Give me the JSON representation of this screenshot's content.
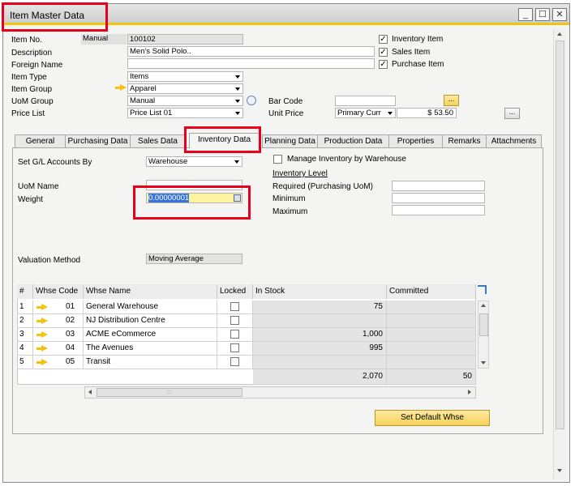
{
  "window": {
    "title": "Item Master Data",
    "controls": {
      "minimize": "_",
      "maximize": "☐",
      "close": "✕"
    }
  },
  "header": {
    "item_no_label": "Item No.",
    "item_no_mode": "Manual",
    "item_no": "100102",
    "description_label": "Description",
    "description": "Men's Solid Polo..",
    "foreign_name_label": "Foreign Name",
    "foreign_name": "",
    "item_type_label": "Item Type",
    "item_type": "Items",
    "item_group_label": "Item Group",
    "item_group": "Apparel",
    "uom_group_label": "UoM Group",
    "uom_group": "Manual",
    "price_list_label": "Price List",
    "price_list": "Price List 01",
    "bar_code_label": "Bar Code",
    "bar_code": "",
    "unit_price_label": "Unit Price",
    "unit_price_currency": "Primary Curr",
    "unit_price": "$ 53.50",
    "ellipsis": "...",
    "inventory_item_label": "Inventory Item",
    "sales_item_label": "Sales Item",
    "purchase_item_label": "Purchase Item",
    "check_mark": "✓"
  },
  "tabs": [
    {
      "label": "General"
    },
    {
      "label": "Purchasing Data"
    },
    {
      "label": "Sales Data"
    },
    {
      "label": "Inventory Data"
    },
    {
      "label": "Planning Data"
    },
    {
      "label": "Production Data"
    },
    {
      "label": "Properties"
    },
    {
      "label": "Remarks"
    },
    {
      "label": "Attachments"
    }
  ],
  "inventory": {
    "gl_label": "Set G/L Accounts By",
    "gl_value": "Warehouse",
    "uom_name_label": "UoM Name",
    "uom_name": "",
    "weight_label": "Weight",
    "weight": "0.00000001",
    "manage_by_wh_label": "Manage Inventory by Warehouse",
    "inventory_level_label": "Inventory Level",
    "required_label": "Required (Purchasing UoM)",
    "minimum_label": "Minimum",
    "maximum_label": "Maximum",
    "valuation_label": "Valuation Method",
    "valuation_value": "Moving Average"
  },
  "grid": {
    "columns": [
      "#",
      "Whse Code",
      "Whse Name",
      "Locked",
      "In Stock",
      "Committed"
    ],
    "rows": [
      {
        "n": "1",
        "code": "01",
        "name": "General Warehouse",
        "in_stock": "75",
        "committed": ""
      },
      {
        "n": "2",
        "code": "02",
        "name": "NJ Distribution Centre",
        "in_stock": "",
        "committed": ""
      },
      {
        "n": "3",
        "code": "03",
        "name": "ACME eCommerce",
        "in_stock": "1,000",
        "committed": ""
      },
      {
        "n": "4",
        "code": "04",
        "name": "The Avenues",
        "in_stock": "995",
        "committed": ""
      },
      {
        "n": "5",
        "code": "05",
        "name": "Transit",
        "in_stock": "",
        "committed": ""
      }
    ],
    "totals": {
      "in_stock": "2,070",
      "committed": "50"
    },
    "hscroll_grip": ":::"
  },
  "buttons": {
    "set_default_whse": "Set Default Whse"
  },
  "colors": {
    "accent_yellow": "#f1c40f",
    "highlight_red": "#e8001c",
    "selected_field": "#fdf3a0",
    "selected_text_bg": "#3875d7"
  }
}
